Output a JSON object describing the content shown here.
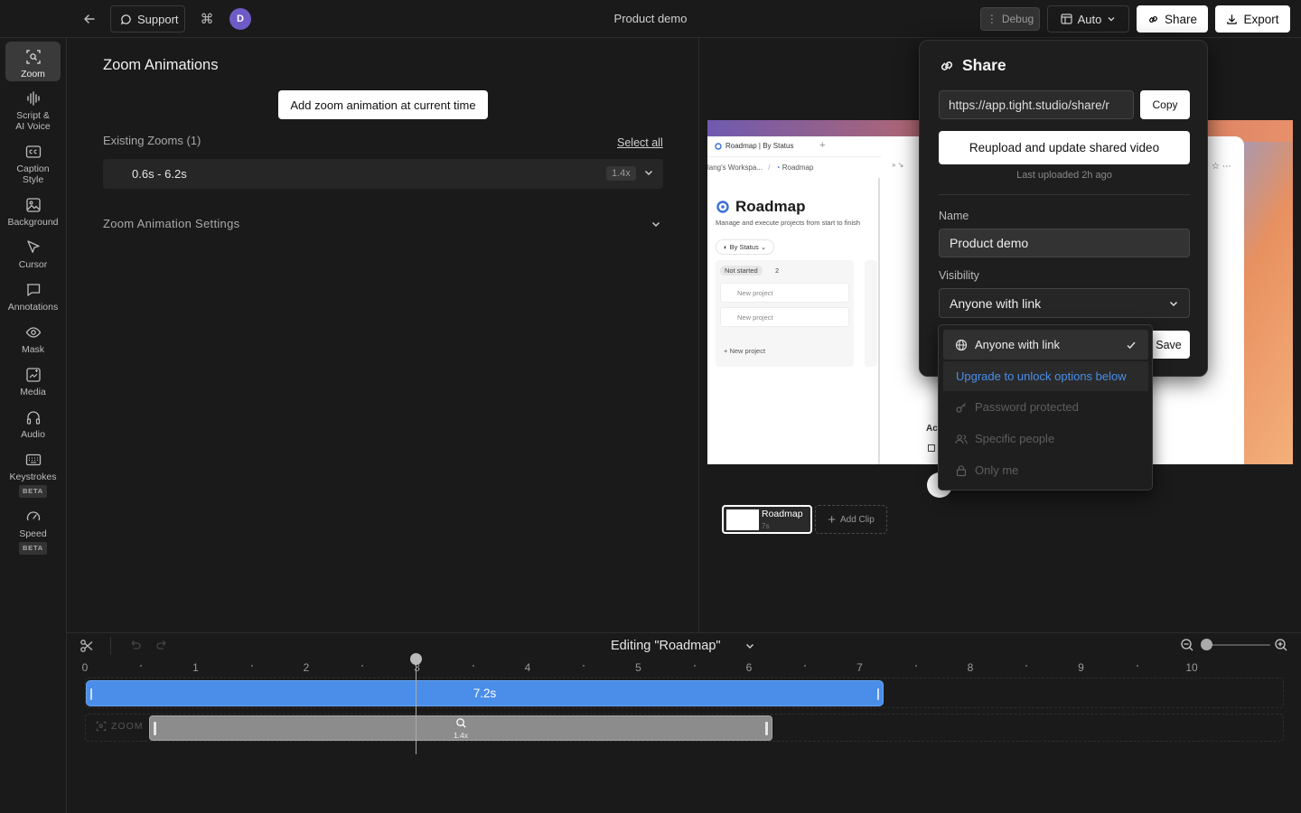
{
  "topbar": {
    "support_label": "Support",
    "avatar_initial": "D",
    "project_title": "Product demo",
    "debug_label": "Debug",
    "auto_label": "Auto",
    "share_label": "Share",
    "export_label": "Export"
  },
  "sidebar": {
    "items": [
      {
        "label": "Zoom",
        "icon": "zoom-icon",
        "active": true
      },
      {
        "label": "Script & AI Voice",
        "icon": "waveform-icon"
      },
      {
        "label": "Caption Style",
        "icon": "caption-icon"
      },
      {
        "label": "Background",
        "icon": "image-icon"
      },
      {
        "label": "Cursor",
        "icon": "cursor-icon"
      },
      {
        "label": "Annotations",
        "icon": "chat-bubble-icon"
      },
      {
        "label": "Mask",
        "icon": "eye-icon"
      },
      {
        "label": "Media",
        "icon": "media-icon"
      },
      {
        "label": "Audio",
        "icon": "headphones-icon"
      },
      {
        "label": "Keystrokes",
        "icon": "keyboard-icon",
        "badge": "BETA"
      },
      {
        "label": "Speed",
        "icon": "gauge-icon",
        "badge": "BETA"
      }
    ]
  },
  "zoom_panel": {
    "title": "Zoom Animations",
    "add_button": "Add zoom animation at current time",
    "existing_label": "Existing Zooms (1)",
    "select_all": "Select all",
    "zooms": [
      {
        "range": "0.6s - 6.2s",
        "scale": "1.4x"
      }
    ],
    "settings_label": "Zoom Animation Settings"
  },
  "preview": {
    "tab_label": "Roadmap | By Status",
    "crumb_workspace": "lang's Workspa...",
    "crumb_page": "Roadmap",
    "heading": "Roadmap",
    "subtitle": "Manage and execute projects from start to finish",
    "view_label": "By Status",
    "status_label": "Not started",
    "status_count": "2",
    "cards": [
      "New project",
      "New project"
    ],
    "new_label": "+ New project",
    "ac_label": "Ac"
  },
  "clips": {
    "clip_name": "Roadmap",
    "clip_duration": "7s",
    "add_clip_label": "Add Clip"
  },
  "share_dialog": {
    "title": "Share",
    "url": "https://app.tight.studio/share/r",
    "copy_label": "Copy",
    "reupload_label": "Reupload and update shared video",
    "last_uploaded": "Last uploaded 2h ago",
    "name_label": "Name",
    "name_value": "Product demo",
    "visibility_label": "Visibility",
    "visibility_value": "Anyone with link",
    "save_label": "Save"
  },
  "visibility_dropdown": {
    "options": [
      {
        "label": "Anyone with link",
        "icon": "globe-icon",
        "selected": true
      },
      {
        "label": "Upgrade to unlock options below",
        "upgrade": true
      },
      {
        "label": "Password protected",
        "icon": "key-icon",
        "disabled": true
      },
      {
        "label": "Specific people",
        "icon": "people-icon",
        "disabled": true
      },
      {
        "label": "Only me",
        "icon": "lock-icon",
        "disabled": true
      }
    ]
  },
  "timeline": {
    "editing_label": "Editing \"Roadmap\"",
    "ticks": [
      "0",
      "1",
      "2",
      "3",
      "4",
      "5",
      "6",
      "7",
      "8",
      "9",
      "10"
    ],
    "main_clip_duration": "7.2s",
    "zoom_track_label": "ZOOM",
    "zoom_track_scale": "1.4x",
    "playhead_time": 3.0
  },
  "colors": {
    "accent_blue": "#4a8eea",
    "upgrade_link": "#4a8eea",
    "avatar": "#6e5bc6"
  }
}
